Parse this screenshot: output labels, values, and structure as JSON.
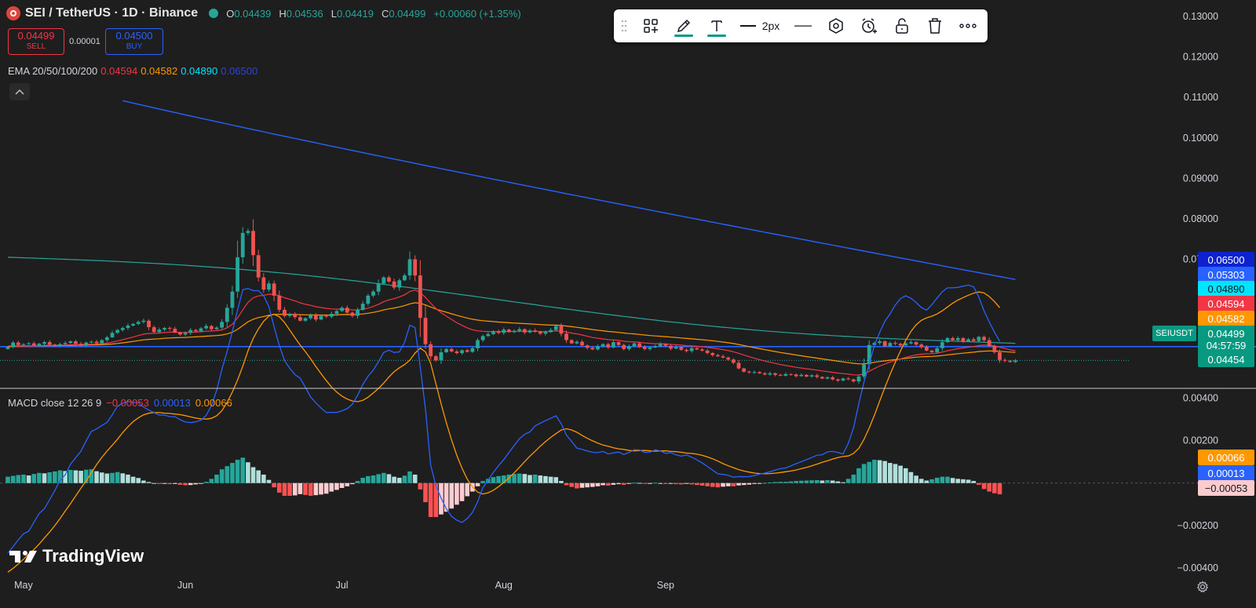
{
  "header": {
    "symbol_title": "SEI / TetherUS · 1D · Binance",
    "ohlc": [
      {
        "key": "O",
        "value": "0.04439"
      },
      {
        "key": "H",
        "value": "0.04536"
      },
      {
        "key": "L",
        "value": "0.04419"
      },
      {
        "key": "C",
        "value": "0.04499"
      }
    ],
    "change": "+0.00060 (+1.35%)"
  },
  "trade": {
    "sell_price": "0.04499",
    "sell_label": "SELL",
    "spread": "0.00001",
    "buy_price": "0.04500",
    "buy_label": "BUY"
  },
  "ema_legend": {
    "label": "EMA 20/50/100/200",
    "values": [
      "0.04594",
      "0.04582",
      "0.04890",
      "0.06500"
    ]
  },
  "macd_legend": {
    "label": "MACD close 12 26 9",
    "values": [
      "−0.00053",
      "0.00013",
      "0.00066"
    ]
  },
  "toolbar": {
    "line_width_label": "2px",
    "icons": [
      "drag-handle-icon",
      "add-widget-icon",
      "pencil-icon",
      "text-icon",
      "line-width-icon",
      "line-style-icon",
      "hexagon-icon",
      "alarm-icon",
      "lock-icon",
      "trash-icon",
      "more-icon"
    ]
  },
  "branding": {
    "name": "TradingView"
  },
  "colors": {
    "up": "#26a69a",
    "down": "#ef5350",
    "ema20": "#f23645",
    "ema50": "#ff9800",
    "ema100": "#26a69a",
    "ema200": "#2962ff",
    "hline": "#2962ff",
    "macd": "#2962ff",
    "signal": "#ff9800"
  },
  "price_axis": {
    "ticks": [
      "0.13000",
      "0.12000",
      "0.11000",
      "0.10000",
      "0.09000",
      "0.08000",
      "0.07000"
    ]
  },
  "price_tags": [
    {
      "text": "0.06500",
      "bg": "#0d22ce",
      "fg": "#ffffff",
      "value": 0.065
    },
    {
      "text": "0.05303",
      "bg": "#2962ff",
      "fg": "#ffffff",
      "value": 0.05303
    },
    {
      "text": "0.04890",
      "bg": "#00e5ff",
      "fg": "#131722",
      "value": 0.0489
    },
    {
      "text": "0.04594",
      "bg": "#f23645",
      "fg": "#ffffff",
      "value": 0.04594
    },
    {
      "text": "0.04582",
      "bg": "#ff9800",
      "fg": "#ffffff",
      "value": 0.04582
    },
    {
      "text": "0.04499",
      "bg": "#089981",
      "fg": "#ffffff",
      "value": 0.04499
    },
    {
      "text": "04:57:59",
      "bg": "#089981",
      "fg": "#ffffff",
      "value": 0.04435
    },
    {
      "text": "0.04454",
      "bg": "#089981",
      "fg": "#ffffff",
      "value": 0.0438
    }
  ],
  "symbol_tag": "SEIUSDT",
  "macd_axis": {
    "ticks": [
      "0.00400",
      "0.00200",
      "−0.00200",
      "−0.00400"
    ]
  },
  "macd_tags": [
    {
      "text": "0.00066",
      "bg": "#ff9800",
      "fg": "#ffffff",
      "value": 0.00066
    },
    {
      "text": "0.00013",
      "bg": "#2962ff",
      "fg": "#ffffff",
      "value": 0.00013
    },
    {
      "text": "−0.00053",
      "bg": "#fccbcd",
      "fg": "#131722",
      "value": -0.00053
    }
  ],
  "time_axis": [
    "May",
    "Jun",
    "Jul",
    "Aug",
    "Sep"
  ],
  "chart_data": [
    {
      "type": "candlestick",
      "title": "SEI / TetherUS · 1D · Binance",
      "x_start": 99,
      "x_note": "day index from 0 (April 1); month ticks at 30=May, 61=Jun, 91=Jul, 122=Aug, 153=Sep",
      "price_levels": [
        0.0484,
        0.04499
      ],
      "ylim": [
        0.03808,
        0.1341
      ],
      "y_ticks": [
        0.13,
        0.12,
        0.11,
        0.1,
        0.09,
        0.08,
        0.07
      ],
      "series": [
        {
          "name": "SEIUSDT",
          "kind": "ohlc",
          "ohlc_path": "close",
          "closes": [
            0.0483,
            0.0494,
            0.0488,
            0.049,
            0.0492,
            0.0487,
            0.0491,
            0.0495,
            0.0489,
            0.0486,
            0.049,
            0.0493,
            0.0497,
            0.0491,
            0.0488,
            0.0494,
            0.0496,
            0.0492,
            0.05,
            0.0507,
            0.0518,
            0.0525,
            0.053,
            0.0536,
            0.054,
            0.0545,
            0.0548,
            0.0532,
            0.052,
            0.0526,
            0.053,
            0.0528,
            0.0519,
            0.0514,
            0.0518,
            0.0525,
            0.0522,
            0.0529,
            0.0535,
            0.0527,
            0.0531,
            0.0545,
            0.058,
            0.062,
            0.0705,
            0.0765,
            0.077,
            0.071,
            0.0655,
            0.0625,
            0.064,
            0.061,
            0.0575,
            0.056,
            0.0565,
            0.0557,
            0.0548,
            0.0554,
            0.0562,
            0.0551,
            0.056,
            0.0558,
            0.0565,
            0.0572,
            0.058,
            0.0568,
            0.056,
            0.0575,
            0.059,
            0.061,
            0.062,
            0.064,
            0.0655,
            0.0645,
            0.063,
            0.0648,
            0.066,
            0.07,
            0.066,
            0.0555,
            0.049,
            0.046,
            0.045,
            0.047,
            0.0478,
            0.0472,
            0.0468,
            0.0475,
            0.0471,
            0.048,
            0.05,
            0.051,
            0.0515,
            0.0522,
            0.0518,
            0.0526,
            0.052,
            0.0523,
            0.0527,
            0.0519,
            0.0524,
            0.0521,
            0.0516,
            0.052,
            0.0525,
            0.0535,
            0.0516,
            0.05,
            0.0492,
            0.0496,
            0.0487,
            0.0481,
            0.0477,
            0.0485,
            0.049,
            0.0482,
            0.0495,
            0.0488,
            0.0478,
            0.0485,
            0.0492,
            0.0483,
            0.0478,
            0.0482,
            0.0485,
            0.049,
            0.0486,
            0.0479,
            0.0483,
            0.0476,
            0.0473,
            0.048,
            0.0477,
            0.0474,
            0.0468,
            0.0463,
            0.046,
            0.0457,
            0.0452,
            0.0444,
            0.043,
            0.0422,
            0.042,
            0.0421,
            0.0418,
            0.0415,
            0.0418,
            0.0414,
            0.0412,
            0.0416,
            0.0415,
            0.0411,
            0.0414,
            0.041,
            0.0413,
            0.0409,
            0.0405,
            0.0408,
            0.0403,
            0.04,
            0.0405,
            0.0403,
            0.0398,
            0.041,
            0.044,
            0.0488,
            0.0493,
            0.0497,
            0.0485,
            0.0493,
            0.0491,
            0.0487,
            0.0492,
            0.0495,
            0.0489,
            0.0483,
            0.0474,
            0.047,
            0.048,
            0.0495,
            0.0505,
            0.05,
            0.0505,
            0.0497,
            0.0502,
            0.0498,
            0.0508,
            0.05,
            0.0485,
            0.047,
            0.0451,
            0.0449,
            0.0446,
            0.045
          ]
        },
        {
          "name": "EMA 20",
          "values_at": "ema20"
        },
        {
          "name": "EMA 50",
          "values_at": "ema50"
        },
        {
          "name": "EMA 100",
          "values_at": "ema100"
        },
        {
          "name": "EMA 200",
          "values_at": "ema200"
        }
      ]
    },
    {
      "type": "histogram+line",
      "title": "MACD close 12 26 9",
      "ylim": [
        -0.00441,
        0.00443
      ],
      "y_ticks": [
        0.004,
        0.002,
        -0.002,
        -0.004
      ],
      "series": [
        {
          "name": "Histogram",
          "values": [
            0.0003,
            0.00034,
            0.00038,
            0.0004,
            0.00036,
            0.00043,
            0.00048,
            0.00046,
            0.00051,
            0.00055,
            0.0006,
            0.00057,
            0.00062,
            0.0006,
            0.00058,
            0.00063,
            0.00065,
            0.00056,
            0.0005,
            0.00045,
            0.00048,
            0.00052,
            0.00046,
            0.0004,
            0.0003,
            0.00024,
            0.00012,
            5e-05,
            0.0,
            -4e-05,
            -3e-05,
            -5e-05,
            -4e-05,
            -8e-05,
            -0.0001,
            -9e-05,
            -6e-05,
            -2e-05,
            6e-05,
            0.0002,
            0.0004,
            0.00065,
            0.0008,
            0.00095,
            0.0011,
            0.0012,
            0.00098,
            0.00075,
            0.0006,
            0.0004,
            0.00015,
            -0.0002,
            -0.00045,
            -0.0006,
            -0.0006,
            -0.00058,
            -0.00052,
            -0.00056,
            -0.0006,
            -0.00057,
            -0.00054,
            -0.0005,
            -0.0004,
            -0.00032,
            -0.00023,
            -0.00015,
            -5e-05,
            0.0001,
            0.00025,
            0.00033,
            0.00036,
            0.00042,
            0.00048,
            0.00042,
            0.0003,
            0.00025,
            0.00035,
            0.00055,
            0.0004,
            -0.0003,
            -0.0009,
            -0.0016,
            -0.0016,
            -0.00148,
            -0.00135,
            -0.0012,
            -0.00102,
            -0.00085,
            -0.00062,
            -0.0004,
            -0.00015,
            0.0001,
            0.0002,
            0.00028,
            0.00033,
            0.00036,
            0.0004,
            0.00043,
            0.00045,
            0.00043,
            0.00038,
            0.0004,
            0.00036,
            0.00033,
            0.0003,
            0.00028,
            0.0001,
            -0.0001,
            -0.00018,
            -0.00025,
            -0.00022,
            -0.0002,
            -0.00018,
            -0.00015,
            -0.0001,
            -0.00012,
            -8e-05,
            -5e-05,
            -8e-05,
            -3e-05,
            2e-05,
            1e-05,
            -3e-05,
            -2e-05,
            2e-05,
            0.0,
            -4e-05,
            -2e-05,
            -5e-05,
            -6e-05,
            -3e-05,
            -6e-05,
            -9e-05,
            -0.00012,
            -0.00015,
            -0.00018,
            -0.0002,
            -0.00017,
            -0.00015,
            -0.00015,
            -0.00011,
            -9e-05,
            -7e-05,
            -4e-05,
            -1e-05,
            1e-05,
            3e-05,
            5e-05,
            6e-05,
            6e-05,
            8e-05,
            0.0001,
            0.00011,
            0.00012,
            0.00013,
            0.00014,
            0.00012,
            0.00014,
            0.00012,
            8e-05,
            4e-05,
            0.0002,
            0.0004,
            0.0007,
            0.0009,
            0.001,
            0.0011,
            0.00108,
            0.00104,
            0.00095,
            0.0009,
            0.00082,
            0.0007,
            0.00052,
            0.00035,
            0.0002,
            0.00012,
            0.00018,
            0.00025,
            0.0003,
            0.0003,
            0.00024,
            0.0002,
            0.00018,
            0.00016,
            0.0001,
            -8e-05,
            -0.00028,
            -0.0004,
            -0.00048,
            -0.00053
          ]
        },
        {
          "name": "MACD",
          "color": "#2962ff"
        },
        {
          "name": "Signal",
          "color": "#ff9800"
        }
      ]
    }
  ]
}
